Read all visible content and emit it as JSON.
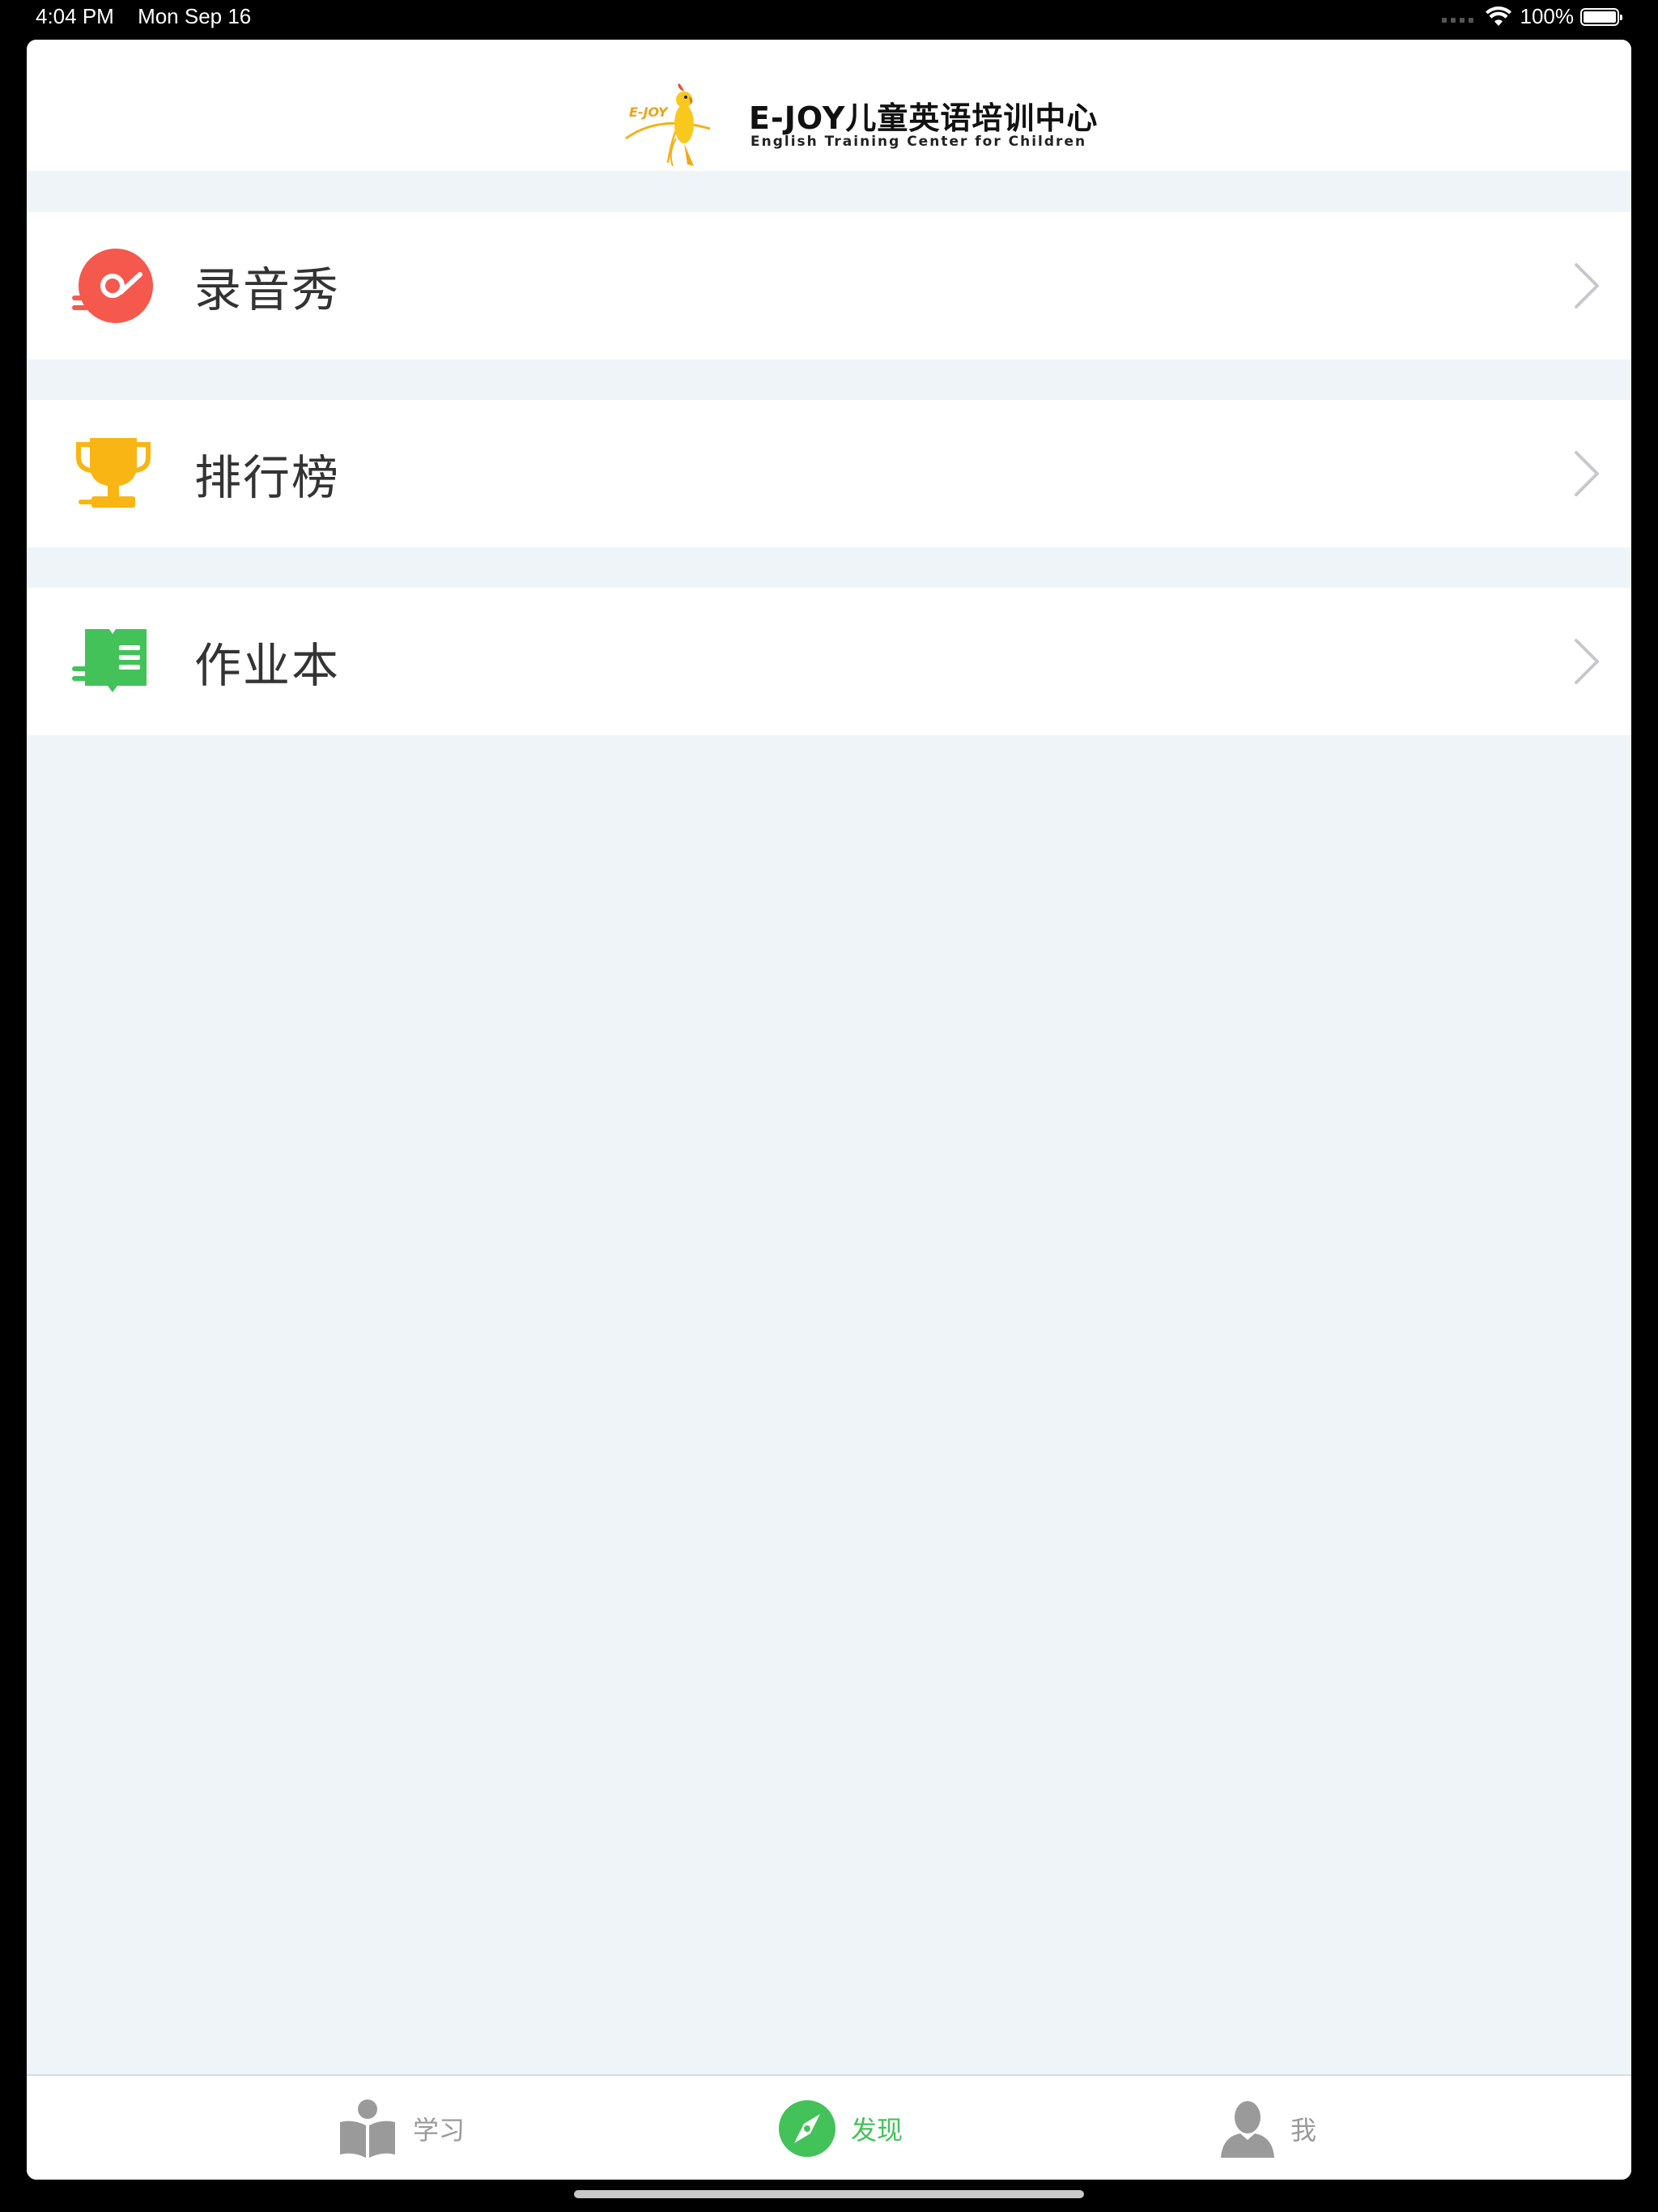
{
  "status_bar": {
    "time": "4:04 PM",
    "date": "Mon Sep 16",
    "battery": "100%"
  },
  "header": {
    "logo_mini": "E-JOY",
    "logo_title": "E-JOY儿童英语培训中心",
    "logo_subtitle": "English Training Center for Children"
  },
  "menu": {
    "items": [
      {
        "label": "录音秀",
        "icon": "record-disc-icon",
        "color": "#f5594e"
      },
      {
        "label": "排行榜",
        "icon": "trophy-icon",
        "color": "#f8b514"
      },
      {
        "label": "作业本",
        "icon": "homework-book-icon",
        "color": "#43c25a"
      }
    ]
  },
  "tabbar": {
    "tabs": [
      {
        "label": "学习",
        "icon": "reading-icon",
        "active": false
      },
      {
        "label": "发现",
        "icon": "compass-icon",
        "active": true
      },
      {
        "label": "我",
        "icon": "user-icon",
        "active": false
      }
    ],
    "active_color": "#43c25a",
    "inactive_color": "#9a9a9a"
  }
}
